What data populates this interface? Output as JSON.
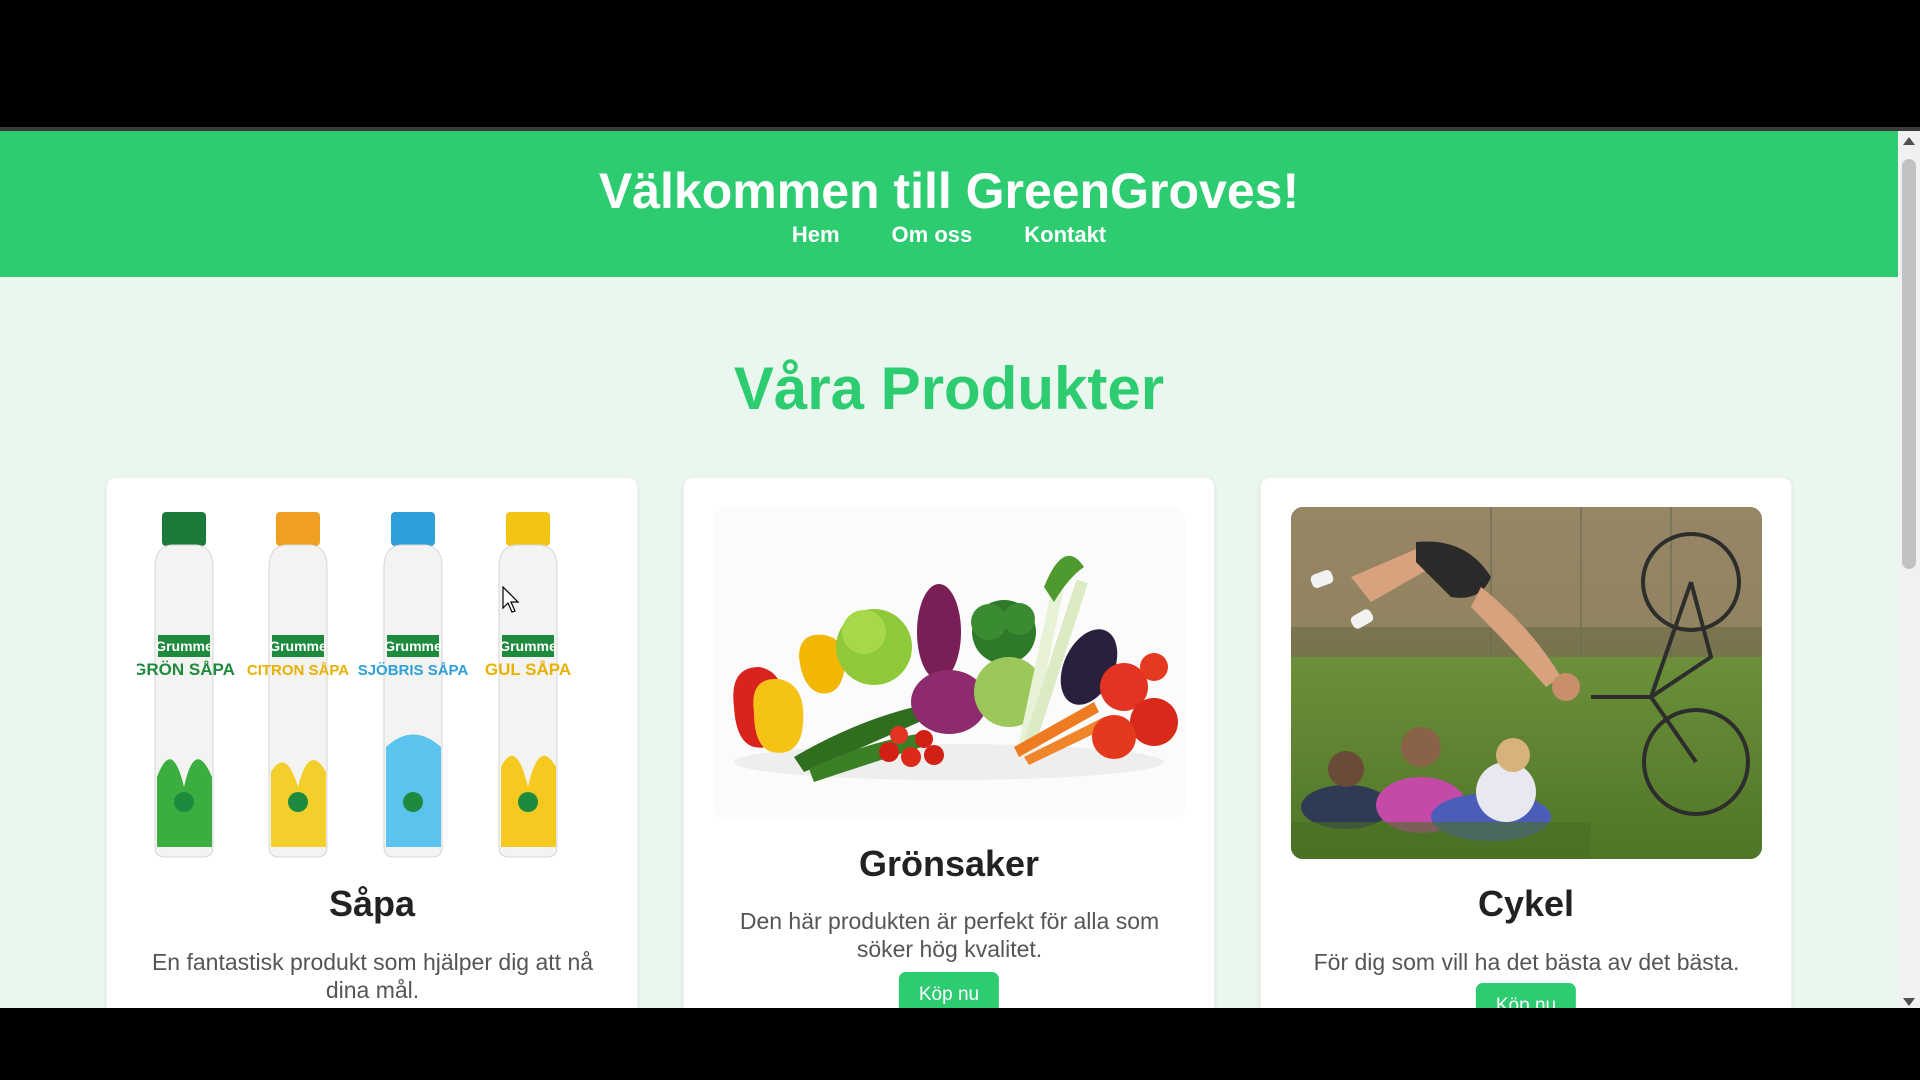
{
  "header": {
    "title": "Välkommen till GreenGroves!",
    "nav": [
      "Hem",
      "Om oss",
      "Kontakt"
    ]
  },
  "main": {
    "section_title": "Våra Produkter",
    "products": [
      {
        "name": "Såpa",
        "description": "En fantastisk produkt som hjälper dig att nå dina mål.",
        "image": "soap-bottles",
        "bottle_labels": [
          "Grumme",
          "GRÖN SÅPA",
          "Grumme",
          "CITRON SÅPA",
          "Grumme",
          "SJÖBRIS SÅPA",
          "Grumme",
          "GUL SÅPA"
        ]
      },
      {
        "name": "Grönsaker",
        "description": "Den här produkten är perfekt för alla som söker hög kvalitet.",
        "button": "Köp nu",
        "image": "vegetables"
      },
      {
        "name": "Cykel",
        "description": "För dig som vill ha det bästa av det bästa.",
        "button": "Köp nu",
        "image": "bicycle-crash-park"
      }
    ]
  },
  "colors": {
    "brand": "#2ecc71",
    "page_bg": "#eaf7ef",
    "card_bg": "#ffffff",
    "heading": "#222222",
    "body_text": "#555555"
  }
}
